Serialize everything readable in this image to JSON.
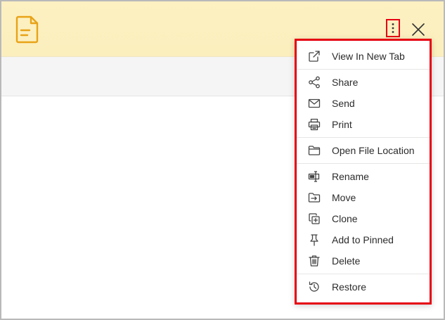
{
  "header": {
    "doc_icon": "document-icon",
    "more_icon": "vertical-ellipsis-icon",
    "close_icon": "close-icon",
    "accent_color": "#e8a317"
  },
  "menu": {
    "highlight_color": "#e60012",
    "items": [
      {
        "label": "View In New Tab",
        "icon": "external-link-icon"
      },
      {
        "label": "Share",
        "icon": "share-icon"
      },
      {
        "label": "Send",
        "icon": "envelope-icon"
      },
      {
        "label": "Print",
        "icon": "printer-icon"
      },
      {
        "label": "Open File Location",
        "icon": "folder-icon"
      },
      {
        "label": "Rename",
        "icon": "rename-icon"
      },
      {
        "label": "Move",
        "icon": "move-folder-icon"
      },
      {
        "label": "Clone",
        "icon": "clone-icon"
      },
      {
        "label": "Add to Pinned",
        "icon": "pin-icon"
      },
      {
        "label": "Delete",
        "icon": "trash-icon"
      },
      {
        "label": "Restore",
        "icon": "history-icon"
      }
    ]
  }
}
